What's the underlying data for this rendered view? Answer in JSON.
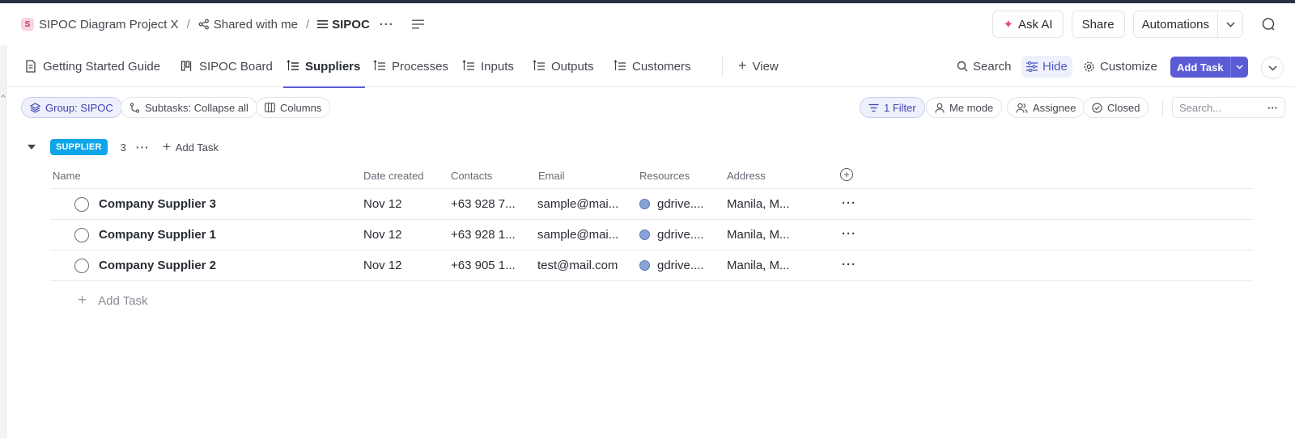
{
  "breadcrumb": {
    "space_initial": "S",
    "space_name": "SIPOC Diagram Project X",
    "shared": "Shared with me",
    "list": "SIPOC",
    "more": "···"
  },
  "header_actions": {
    "ask_ai": "Ask AI",
    "share": "Share",
    "automations": "Automations"
  },
  "view_tabs": [
    {
      "label": "Getting Started Guide"
    },
    {
      "label": "SIPOC Board"
    },
    {
      "label": "Suppliers"
    },
    {
      "label": "Processes"
    },
    {
      "label": "Inputs"
    },
    {
      "label": "Outputs"
    },
    {
      "label": "Customers"
    },
    {
      "label": "View"
    }
  ],
  "toolbar": {
    "search": "Search",
    "hide": "Hide",
    "customize": "Customize",
    "add_task": "Add Task"
  },
  "filters": {
    "group": "Group: SIPOC",
    "subtasks": "Subtasks: Collapse all",
    "columns": "Columns",
    "filter": "1 Filter",
    "me_mode": "Me mode",
    "assignee": "Assignee",
    "closed": "Closed",
    "search_placeholder": "Search...",
    "more": "···"
  },
  "group": {
    "label": "SUPPLIER",
    "count": "3",
    "dots": "···",
    "add_task": "Add Task",
    "badge_color": "#0ea5e9"
  },
  "table": {
    "columns": [
      "Name",
      "Date created",
      "Contacts",
      "Email",
      "Resources",
      "Address"
    ],
    "rows": [
      {
        "name": "Company Supplier 3",
        "date": "Nov 12",
        "contacts": "+63 928 7...",
        "email": "sample@mai...",
        "resources": "gdrive....",
        "address": "Manila, M..."
      },
      {
        "name": "Company Supplier 1",
        "date": "Nov 12",
        "contacts": "+63 928 1...",
        "email": "sample@mai...",
        "resources": "gdrive....",
        "address": "Manila, M..."
      },
      {
        "name": "Company Supplier 2",
        "date": "Nov 12",
        "contacts": "+63 905 1...",
        "email": "test@mail.com",
        "resources": "gdrive....",
        "address": "Manila, M..."
      }
    ],
    "row_more": "···",
    "add_task": "Add Task"
  },
  "colors": {
    "accent": "#5b5bd6"
  }
}
